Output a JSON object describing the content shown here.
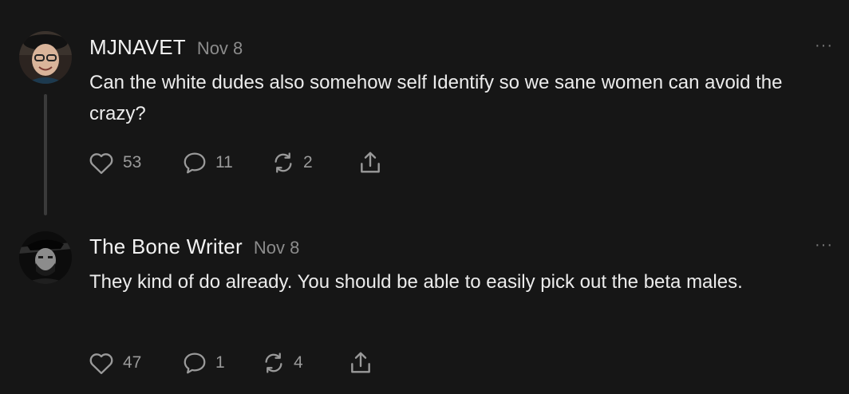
{
  "comments": [
    {
      "author": "MJNAVET",
      "date": "Nov 8",
      "text": "Can the white dudes also somehow self Identify so we sane women can avoid the crazy?",
      "likes": "53",
      "replies": "11",
      "restacks": "2",
      "more_label": "···"
    },
    {
      "author": "The Bone Writer",
      "date": "Nov 8",
      "text": "They kind of do already. You should be able to easily pick out the beta males.",
      "likes": "47",
      "replies": "1",
      "restacks": "4",
      "more_label": "···"
    }
  ],
  "icons": {
    "like": "heart-icon",
    "reply": "comment-bubble-icon",
    "restack": "restack-arrows-icon",
    "share": "share-upload-icon",
    "more": "more-options-icon"
  },
  "colors": {
    "background": "#161616",
    "text": "#ececec",
    "muted": "#8c8c8c",
    "icon": "#9a9a9a"
  }
}
